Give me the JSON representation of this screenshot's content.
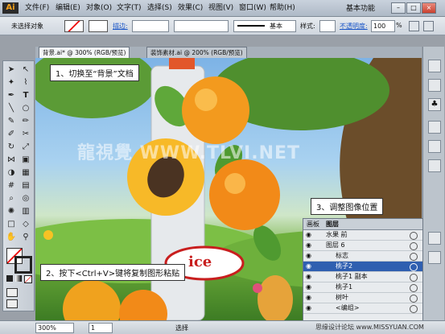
{
  "app": {
    "logo": "Ai",
    "workspace": "基本功能"
  },
  "menu": [
    "文件(F)",
    "编辑(E)",
    "对象(O)",
    "文字(T)",
    "选择(S)",
    "效果(C)",
    "视图(V)",
    "窗口(W)",
    "帮助(H)"
  ],
  "window_buttons": [
    "–",
    "□",
    "×"
  ],
  "control_bar": {
    "selection_label": "未选择对象",
    "stroke_label": "描边:",
    "stroke_style_value": "基本",
    "style_label": "样式:",
    "opacity_label": "不透明度:",
    "opacity_value": "100",
    "opacity_unit": "%"
  },
  "tabs": [
    {
      "label": "背景.ai* @ 300% (RGB/预览)",
      "active": true
    },
    {
      "label": "装饰素材.ai @ 200% (RGB/预览)",
      "active": false
    }
  ],
  "callouts": {
    "step1": "1、切换至“背景”文档",
    "step2": "2、按下<Ctrl+V>键将复制图形粘贴",
    "step3": "3、调整图像位置"
  },
  "watermark": "思缘设计论坛 www.MISSYUAN.COM",
  "canvas_watermark": "龍視覺 WWW.TLVI.NET",
  "logo_text": "ice",
  "layers_panel": {
    "tabs": [
      "画板",
      "图层"
    ],
    "rows": [
      {
        "name": "水果 前",
        "indent": 0,
        "selected": false
      },
      {
        "name": "图层 6",
        "indent": 0,
        "selected": false
      },
      {
        "name": "标志",
        "indent": 1,
        "selected": false
      },
      {
        "name": "桃子2",
        "indent": 1,
        "selected": true
      },
      {
        "name": "桃子1 副本",
        "indent": 1,
        "selected": false
      },
      {
        "name": "桃子1",
        "indent": 1,
        "selected": false
      },
      {
        "name": "树叶",
        "indent": 1,
        "selected": false
      },
      {
        "name": "<编组>",
        "indent": 1,
        "selected": false
      }
    ]
  },
  "status_bar": {
    "zoom": "300%",
    "page": "1",
    "mode": "选择"
  }
}
